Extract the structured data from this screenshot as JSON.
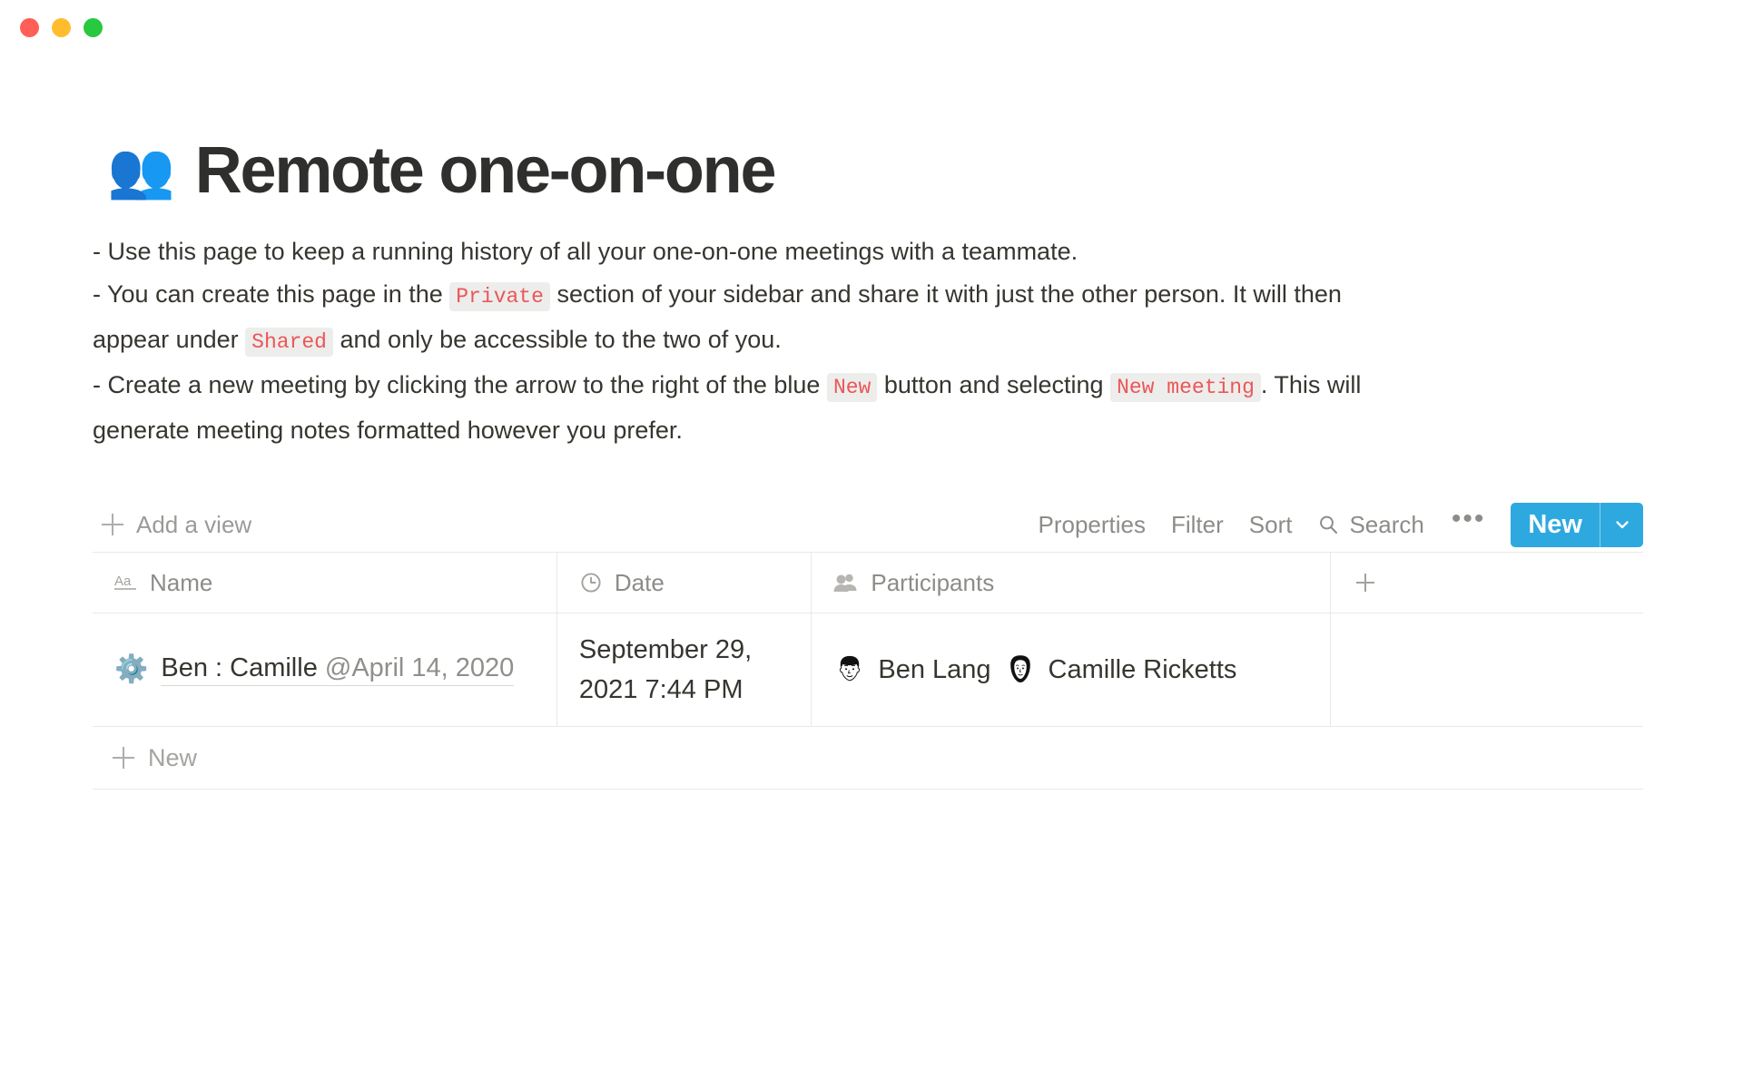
{
  "window": {
    "traffic_lights": [
      {
        "name": "close",
        "color": "#FF5F56"
      },
      {
        "name": "minimize",
        "color": "#FFBD2E"
      },
      {
        "name": "zoom",
        "color": "#27C93F"
      }
    ]
  },
  "page": {
    "emoji": "👥",
    "title": "Remote one-on-one",
    "description": {
      "line1": "- Use this page to keep a running history of all your one-on-one meetings with a teammate.",
      "line2_a": "- You can create this page in the",
      "line2_code": "Private",
      "line2_b": "section of your sidebar and share it with just the other person. It will then appear under",
      "line2_code2": "Shared",
      "line2_c": "and only be accessible to the two of you.",
      "line3_a": "- Create a new meeting by clicking the arrow to the right of the blue",
      "line3_code": "New",
      "line3_b": "button and selecting",
      "line3_code2": "New meeting",
      "line3_c": ". This will generate meeting notes formatted however you prefer."
    }
  },
  "toolbar": {
    "add_view_label": "Add a view",
    "properties_label": "Properties",
    "filter_label": "Filter",
    "sort_label": "Sort",
    "search_label": "Search",
    "more_label": "•••",
    "new_label": "New",
    "accent_color": "#2EA9E0"
  },
  "table": {
    "columns": [
      {
        "label": "Name",
        "icon": "text-aa-icon"
      },
      {
        "label": "Date",
        "icon": "clock-icon"
      },
      {
        "label": "Participants",
        "icon": "people-icon"
      },
      {
        "label": "",
        "icon": "plus-icon"
      }
    ],
    "rows": [
      {
        "icon": "⚙️",
        "name": "Ben : Camille ",
        "name_mention": "@April 14, 2020",
        "date": "September 29, 2021 7:44 PM",
        "participants": [
          {
            "name": "Ben Lang"
          },
          {
            "name": "Camille Ricketts"
          }
        ]
      }
    ],
    "new_row_label": "New"
  }
}
